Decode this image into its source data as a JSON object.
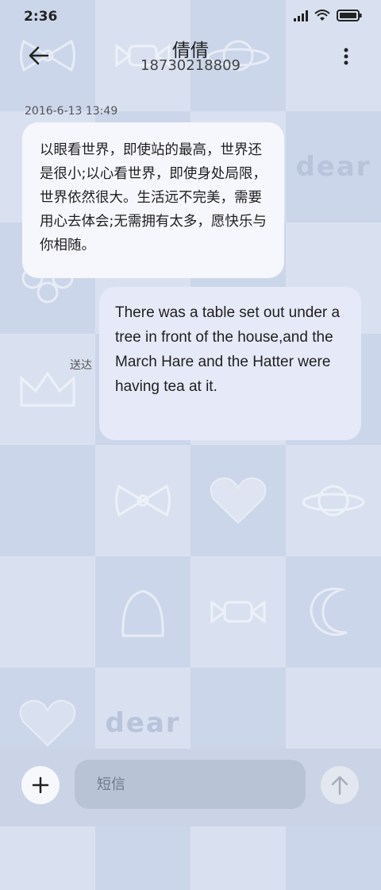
{
  "status_bar": {
    "time": "2:36"
  },
  "header": {
    "contact_name": "倩倩",
    "phone_number": "18730218809"
  },
  "conversation": {
    "timestamp": "2016-6-13 13:49",
    "messages": [
      {
        "direction": "incoming",
        "text": "以眼看世界，即使站的最高，世界还是很小;以心看世界，即使身处局限，世界依然很大。生活远不完美，需要用心去体会;无需拥有太多，愿快乐与你相随。"
      },
      {
        "direction": "outgoing",
        "text": "There was a table set out under a tree in front of the house,and the March Hare and the Hatter were having tea at it.",
        "status": "送达"
      }
    ]
  },
  "composer": {
    "placeholder": "短信"
  },
  "wallpaper": {
    "word": "dear"
  },
  "colors": {
    "accent_bubble_in": "#f6f7fc",
    "accent_bubble_out": "#e6e9f7",
    "background": "#d3dcec"
  }
}
